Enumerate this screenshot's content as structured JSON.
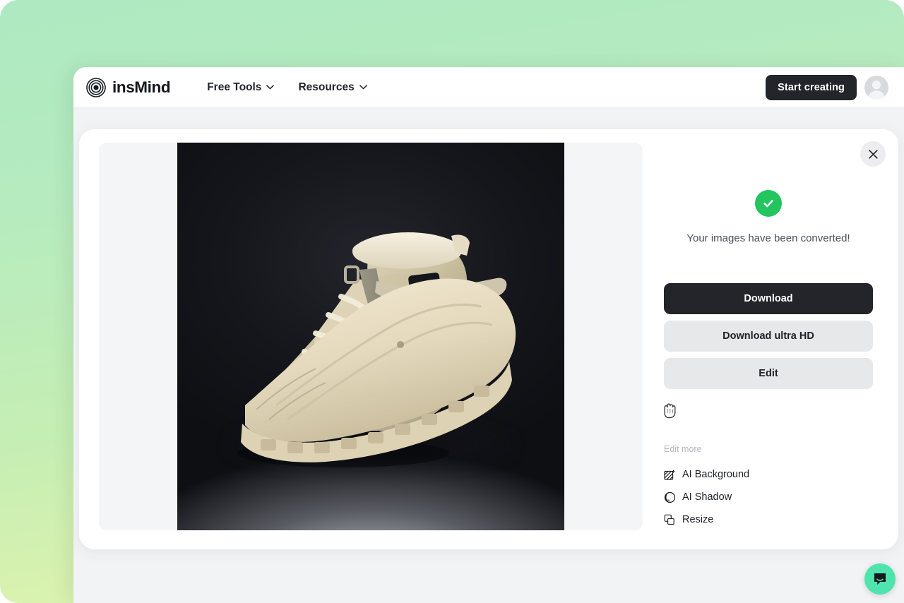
{
  "header": {
    "brand_name": "insMind",
    "logo_icon": "concentric-rings-logo",
    "nav_items": [
      {
        "label": "Free Tools",
        "icon": "chevron-down-icon"
      },
      {
        "label": "Resources",
        "icon": "chevron-down-icon"
      }
    ],
    "start_creating_label": "Start creating",
    "avatar_icon": "user-avatar-silhouette"
  },
  "modal": {
    "close_icon": "close-x-icon",
    "preview": {
      "image_alt": "beige high-top hiking boot on dark gradient studio background"
    },
    "status": {
      "icon": "success-check-icon",
      "icon_color": "#22c55e",
      "message": "Your images have been converted!"
    },
    "buttons": [
      {
        "label": "Download",
        "style": "primary"
      },
      {
        "label": "Download ultra HD",
        "style": "secondary"
      },
      {
        "label": "Edit",
        "style": "secondary"
      }
    ],
    "cursor": {
      "icon": "grab-hand-cursor"
    },
    "edit_more": {
      "label": "Edit more",
      "options": [
        {
          "label": "AI Background",
          "icon": "ai-background-icon"
        },
        {
          "label": "AI Shadow",
          "icon": "ai-shadow-icon"
        },
        {
          "label": "Resize",
          "icon": "resize-icon"
        }
      ]
    }
  },
  "chat_widget": {
    "icon": "chat-bubble-smile-icon",
    "color": "#4fe3ad"
  },
  "theme": {
    "backdrop_gradient_start": "#aee9c1",
    "backdrop_gradient_end": "#e9f5ab",
    "dark": "#23252b",
    "page_bg": "#f2f3f5"
  }
}
